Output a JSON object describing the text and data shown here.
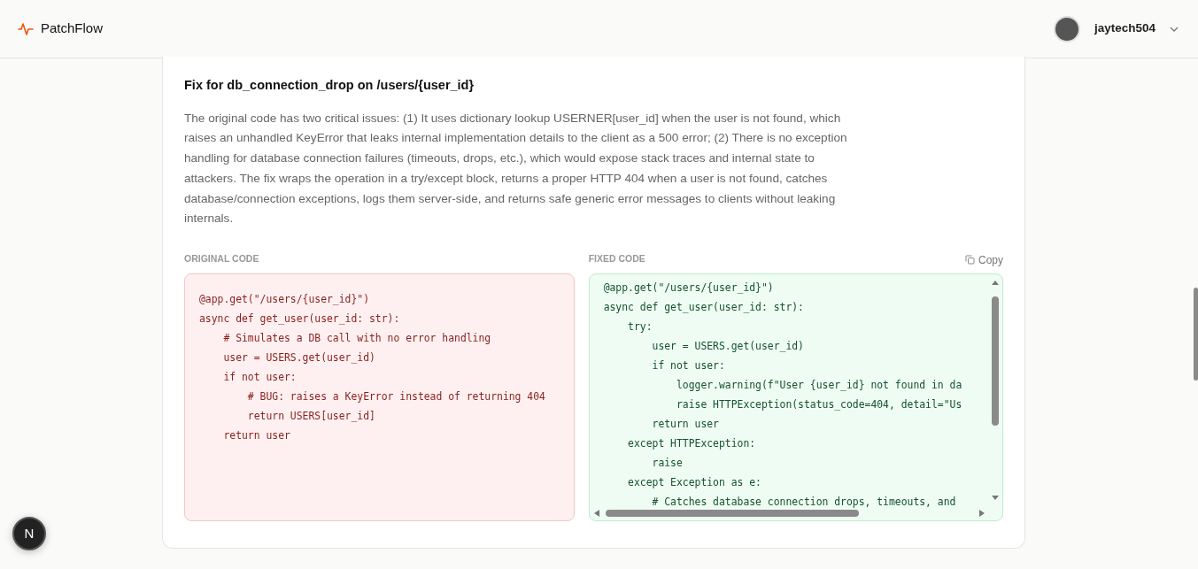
{
  "navbar": {
    "brand": "PatchFlow",
    "user": {
      "name": "jaytech504"
    }
  },
  "fix": {
    "title": "Fix for db_connection_drop on /users/{user_id}",
    "explanation": "The original code has two critical issues: (1) It uses dictionary lookup USERNER[user_id] when the user is not found, which raises an unhandled KeyError that leaks internal implementation details to the client as a 500 error; (2) There is no exception handling for database connection failures (timeouts, drops, etc.), which would expose stack traces and internal state to attackers. The fix wraps the operation in a try/except block, returns a proper HTTP 404 when a user is not found, catches database/connection exceptions, logs them server-side, and returns safe generic error messages to clients without leaking internals.",
    "panels": [
      {
        "label": "ORIGINAL CODE",
        "kind": "original",
        "lines": [
          "@app.get(\"/users/{user_id}\")",
          "async def get_user(user_id: str):",
          "    # Simulates a DB call with no error handling",
          "    user = USERS.get(user_id)",
          "    if not user:",
          "        # BUG: raises a KeyError instead of returning 404",
          "        return USERS[user_id]",
          "    return user"
        ]
      },
      {
        "label": "FIXED CODE",
        "kind": "fixed",
        "copy_label": "Copy",
        "lines": [
          "@app.get(\"/users/{user_id}\")",
          "async def get_user(user_id: str):",
          "    try:",
          "        user = USERS.get(user_id)",
          "        if not user:",
          "            logger.warning(f\"User {user_id} not found in da",
          "            raise HTTPException(status_code=404, detail=\"Us",
          "        return user",
          "    except HTTPException:",
          "        raise",
          "    except Exception as e:",
          "        # Catches database connection drops, timeouts, and"
        ]
      }
    ]
  },
  "dev_badge": {
    "label": "N"
  }
}
